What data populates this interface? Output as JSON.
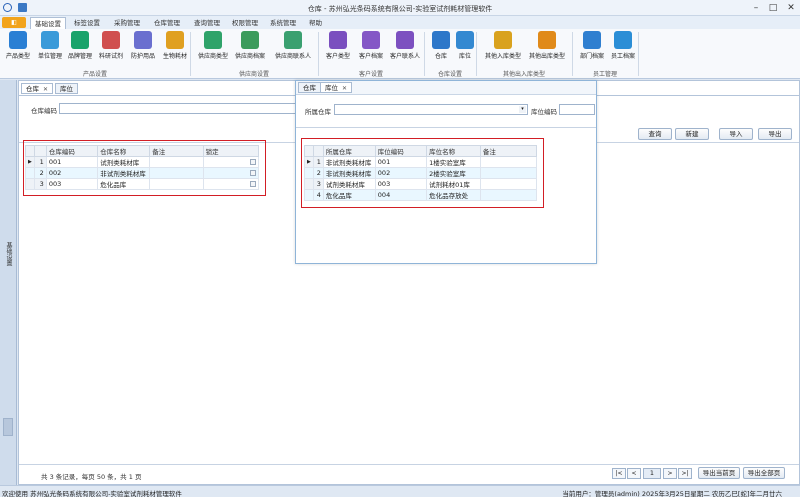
{
  "window": {
    "title": "仓库 - 苏州弘光条码系统有限公司-实验室试剂耗材管理软件",
    "min_label": "–",
    "max_label": "□",
    "close_label": "✕"
  },
  "app_button_label": "◧",
  "ribbon_tabs": [
    "基础设置",
    "标签设置",
    "采购管理",
    "仓库管理",
    "查询管理",
    "权限管理",
    "系统管理",
    "帮助"
  ],
  "ribbon_buttons": [
    {
      "label": "产品类型",
      "icon": "product-type-icon",
      "color": "#2a7fd4"
    },
    {
      "label": "单位管理",
      "icon": "unit-icon",
      "color": "#3a9ad9"
    },
    {
      "label": "品牌管理",
      "icon": "brand-icon",
      "color": "#1aa36b"
    },
    {
      "label": "料研试剂",
      "icon": "reagent-icon",
      "color": "#d04f4f"
    },
    {
      "label": "防护用品",
      "icon": "protection-icon",
      "color": "#6a6fcf"
    },
    {
      "label": "生物耗材",
      "icon": "bio-icon",
      "color": "#e0a020"
    },
    {
      "label": "供应商类型",
      "icon": "supplier-type-icon",
      "color": "#2fa36a"
    },
    {
      "label": "供应商档案",
      "icon": "supplier-file-icon",
      "color": "#3c9b5c"
    },
    {
      "label": "供应商联系人",
      "icon": "supplier-contact-icon",
      "color": "#3aa070"
    },
    {
      "label": "客户类型",
      "icon": "customer-type-icon",
      "color": "#7a4fbf"
    },
    {
      "label": "客户档案",
      "icon": "customer-file-icon",
      "color": "#8457c6"
    },
    {
      "label": "客户联系人",
      "icon": "customer-contact-icon",
      "color": "#7c50c0"
    },
    {
      "label": "仓库",
      "icon": "warehouse-icon",
      "color": "#2d77c9"
    },
    {
      "label": "库位",
      "icon": "location-icon",
      "color": "#3489d1"
    },
    {
      "label": "其他入库类型",
      "icon": "other-in-icon",
      "color": "#d9a21e"
    },
    {
      "label": "其他出库类型",
      "icon": "other-out-icon",
      "color": "#e08a1a"
    },
    {
      "label": "部门档案",
      "icon": "department-icon",
      "color": "#2f7fd0"
    },
    {
      "label": "员工档案",
      "icon": "employee-icon",
      "color": "#2b8ed6"
    }
  ],
  "ribbon_groups": [
    "产品设置",
    "供应商设置",
    "客户设置",
    "仓库设置",
    "其他出入库类型",
    "员工管理"
  ],
  "left_panel_label": "基础设置",
  "main": {
    "tabs": [
      "仓库",
      "库位"
    ],
    "filter_label": "仓库编码",
    "buttons": [
      "查询",
      "新建",
      "导入",
      "导出"
    ],
    "grid": {
      "columns": [
        "仓库编码",
        "仓库名称",
        "备注",
        "锁定"
      ],
      "rows": [
        {
          "no": "1",
          "code": "001",
          "name": "试剂类耗材库",
          "note": ""
        },
        {
          "no": "2",
          "code": "002",
          "name": "非试剂类耗材库",
          "note": ""
        },
        {
          "no": "3",
          "code": "003",
          "name": "危化品库",
          "note": ""
        }
      ]
    },
    "pagination_text": "共 3 条记录，每页 50 条，共 1 页",
    "page_buttons": [
      "|<",
      "<",
      ">",
      ">|"
    ],
    "current_page": "1",
    "export_current_label": "导出当前页",
    "export_all_label": "导出全部页"
  },
  "float_window": {
    "tabs": [
      "仓库",
      "库位"
    ],
    "warehouse_label": "所属仓库",
    "location_label": "库位编码",
    "grid": {
      "columns": [
        "所属仓库",
        "库位编码",
        "库位名称",
        "备注"
      ],
      "rows": [
        {
          "no": "1",
          "warehouse": "非试剂类耗材库",
          "code": "001",
          "name": "1楼实验室库",
          "note": ""
        },
        {
          "no": "2",
          "warehouse": "非试剂类耗材库",
          "code": "002",
          "name": "2楼实验室库",
          "note": ""
        },
        {
          "no": "3",
          "warehouse": "试剂类耗材库",
          "code": "003",
          "name": "试剂耗材01库",
          "note": ""
        },
        {
          "no": "4",
          "warehouse": "危化品库",
          "code": "004",
          "name": "危化品存放处",
          "note": ""
        }
      ]
    }
  },
  "status": {
    "left": "欢迎使用 苏州弘光条码系统有限公司-实验室试剂耗材管理软件",
    "right": "当前用户：管理员(admin)  2025年3月25日星期二 农历乙巳[蛇]年二月廿六"
  }
}
